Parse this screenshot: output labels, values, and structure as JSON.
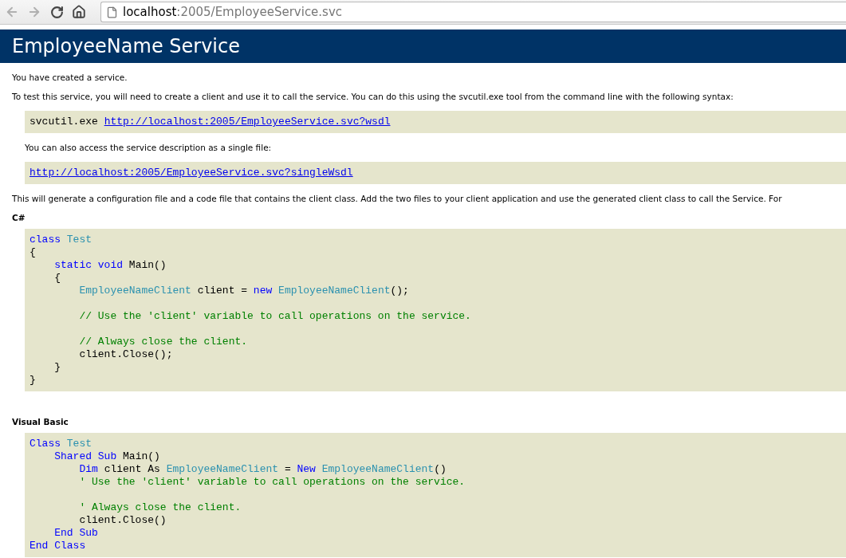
{
  "browser": {
    "back": {
      "disabled": true
    },
    "forward": {
      "disabled": true
    },
    "address": {
      "host": "localhost",
      "path": ":2005/EmployeeService.svc"
    }
  },
  "page": {
    "title": "EmployeeName Service",
    "intro": "You have created a service.",
    "instructions": "To test this service, you will need to create a client and use it to call the service. You can do this using the svcutil.exe tool from the command line with the following syntax:",
    "command": {
      "text": "svcutil.exe",
      "link": "http://localhost:2005/EmployeeService.svc?wsdl"
    },
    "single_file_note": "You can also access the service description as a single file:",
    "single_file_link": "http://localhost:2005/EmployeeService.svc?singleWsdl",
    "generate_note": "This will generate a configuration file and a code file that contains the client class. Add the two files to your client application and use the generated client class to call the Service. For",
    "examples": [
      {
        "heading": "C#",
        "lines": [
          {
            "kind": "code",
            "tokens": [
              {
                "kind": "keyword",
                "text": "class "
              },
              {
                "kind": "type",
                "text": "Test"
              }
            ]
          },
          {
            "kind": "code",
            "tokens": [
              {
                "kind": "plain",
                "text": "{"
              }
            ]
          },
          {
            "kind": "code",
            "tokens": [
              {
                "kind": "keyword",
                "text": "    static void "
              },
              {
                "kind": "plain",
                "text": "Main()"
              }
            ]
          },
          {
            "kind": "code",
            "tokens": [
              {
                "kind": "plain",
                "text": "    {"
              }
            ]
          },
          {
            "kind": "code",
            "tokens": [
              {
                "kind": "type",
                "text": "        EmployeeNameClient"
              },
              {
                "kind": "plain",
                "text": " client = "
              },
              {
                "kind": "keyword",
                "text": "new "
              },
              {
                "kind": "type",
                "text": "EmployeeNameClient"
              },
              {
                "kind": "plain",
                "text": "();"
              }
            ]
          },
          {
            "kind": "blank"
          },
          {
            "kind": "code",
            "tokens": [
              {
                "kind": "comment",
                "text": "        // Use the 'client' variable to call operations on the service."
              }
            ]
          },
          {
            "kind": "blank"
          },
          {
            "kind": "code",
            "tokens": [
              {
                "kind": "comment",
                "text": "        // Always close the client."
              }
            ]
          },
          {
            "kind": "code",
            "tokens": [
              {
                "kind": "plain",
                "text": "        client.Close();"
              }
            ]
          },
          {
            "kind": "code",
            "tokens": [
              {
                "kind": "plain",
                "text": "    }"
              }
            ]
          },
          {
            "kind": "code",
            "tokens": [
              {
                "kind": "plain",
                "text": "}"
              }
            ]
          }
        ]
      },
      {
        "heading": "Visual Basic",
        "lines": [
          {
            "kind": "code",
            "tokens": [
              {
                "kind": "keyword",
                "text": "Class "
              },
              {
                "kind": "type",
                "text": "Test"
              }
            ]
          },
          {
            "kind": "code",
            "tokens": [
              {
                "kind": "keyword",
                "text": "    Shared Sub "
              },
              {
                "kind": "plain",
                "text": "Main()"
              }
            ]
          },
          {
            "kind": "code",
            "tokens": [
              {
                "kind": "keyword",
                "text": "        Dim "
              },
              {
                "kind": "plain",
                "text": "client As "
              },
              {
                "kind": "type",
                "text": "EmployeeNameClient"
              },
              {
                "kind": "plain",
                "text": " = "
              },
              {
                "kind": "keyword",
                "text": "New "
              },
              {
                "kind": "type",
                "text": "EmployeeNameClient"
              },
              {
                "kind": "plain",
                "text": "()"
              }
            ]
          },
          {
            "kind": "code",
            "tokens": [
              {
                "kind": "comment",
                "text": "        ' Use the 'client' variable to call operations on the service."
              }
            ]
          },
          {
            "kind": "blank"
          },
          {
            "kind": "code",
            "tokens": [
              {
                "kind": "comment",
                "text": "        ' Always close the client."
              }
            ]
          },
          {
            "kind": "code",
            "tokens": [
              {
                "kind": "plain",
                "text": "        client.Close()"
              }
            ]
          },
          {
            "kind": "code",
            "tokens": [
              {
                "kind": "keyword",
                "text": "    End Sub"
              }
            ]
          },
          {
            "kind": "code",
            "tokens": [
              {
                "kind": "keyword",
                "text": "End Class"
              }
            ]
          }
        ]
      }
    ]
  }
}
